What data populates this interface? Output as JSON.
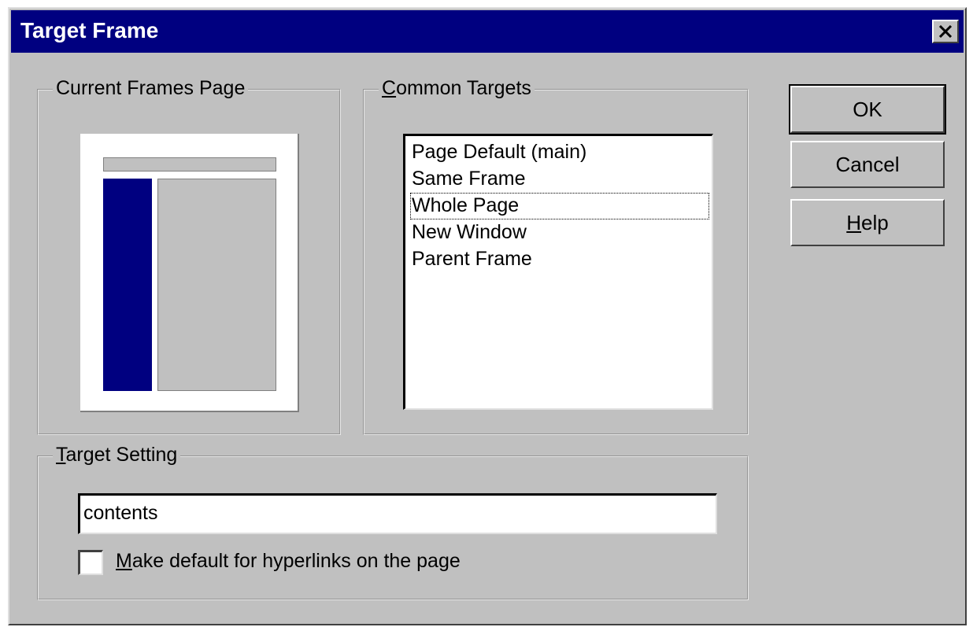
{
  "dialog": {
    "title": "Target Frame"
  },
  "groups": {
    "current_frames_page": "Current Frames Page",
    "common_targets_mnemonic": "C",
    "common_targets_rest": "ommon Targets",
    "target_setting_mnemonic": "T",
    "target_setting_rest": "arget Setting"
  },
  "common_targets": [
    "Page Default (main)",
    "Same Frame",
    "Whole Page",
    "New Window",
    "Parent Frame"
  ],
  "focused_target": "Whole Page",
  "buttons": {
    "ok": "OK",
    "cancel": "Cancel",
    "help_mnemonic": "H",
    "help_rest": "elp"
  },
  "target_setting": {
    "value": "contents",
    "checkbox_mnemonic": "M",
    "checkbox_label_rest": "ake default for hyperlinks on the page",
    "checkbox_checked": false
  },
  "colors": {
    "titlebar": "#000080",
    "face": "#c0c0c0",
    "selected_frame": "#000080"
  },
  "icons": {
    "close": "close-icon"
  }
}
